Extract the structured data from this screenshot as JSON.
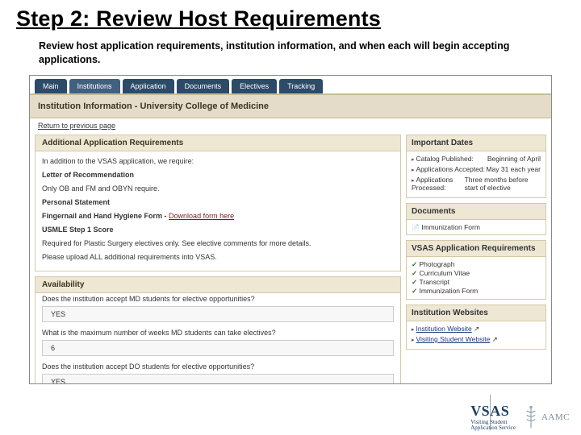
{
  "slide": {
    "title": "Step 2: Review Host Requirements",
    "subtitle": "Review host application requirements, institution information, and when each will begin accepting applications."
  },
  "tabs": [
    "Main",
    "Institutions",
    "Application",
    "Documents",
    "Electives",
    "Tracking"
  ],
  "banner": "Institution Information - University College of Medicine",
  "return_link": "Return to previous page",
  "left": {
    "req": {
      "head": "Additional Application Requirements",
      "intro": "In addition to the VSAS application, we require:",
      "items": {
        "lor_head": "Letter of Recommendation",
        "lor_body": "Only OB and FM and OBYN require.",
        "ps_head": "Personal Statement",
        "form_head": "Fingernail and Hand Hygiene Form -",
        "form_link": "Download form here",
        "usmle_head": "USMLE Step 1 Score",
        "usmle_body": "Required for Plastic Surgery electives only. See elective comments for more details.",
        "upload": "Please upload ALL additional requirements into VSAS."
      }
    },
    "avail": {
      "head": "Availability",
      "q1": "Does the institution accept MD students for elective opportunities?",
      "a1": "YES",
      "q2": "What is the maximum number of weeks MD students can take electives?",
      "a2": "6",
      "q3": "Does the institution accept DO students for elective opportunities?",
      "a3": "YES"
    }
  },
  "right": {
    "dates": {
      "head": "Important Dates",
      "rows": [
        {
          "k": "Catalog Published:",
          "v": "Beginning of April"
        },
        {
          "k": "Applications Accepted:",
          "v": "May 31 each year"
        },
        {
          "k": "Applications Processed:",
          "v": "Three months before start of elective"
        }
      ]
    },
    "docs": {
      "head": "Documents",
      "item": "Immunization Form"
    },
    "vsas": {
      "head": "VSAS Application Requirements",
      "items": [
        "Photograph",
        "Curriculum Vitae",
        "Transcript",
        "Immunization Form"
      ]
    },
    "web": {
      "head": "Institution Websites",
      "items": [
        "Institution Website",
        "Visiting Student Website"
      ]
    }
  },
  "logo": {
    "vsas": "VSAS",
    "vsas_sub1": "Visiting Student",
    "vsas_sub2": "Application Service",
    "aamc": "AAMC"
  }
}
